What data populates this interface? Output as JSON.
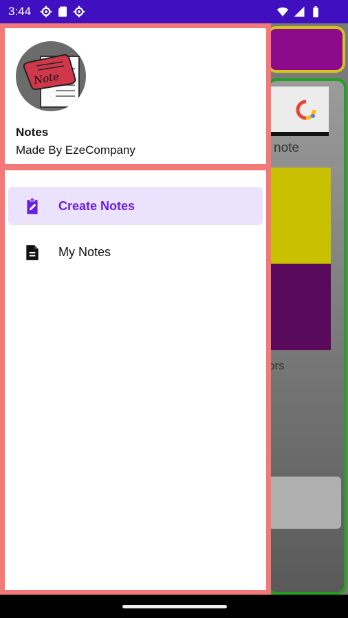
{
  "status_bar": {
    "time": "3:44",
    "left_icons": [
      "settings-icon",
      "sd-card-icon",
      "settings-icon"
    ],
    "right_icons": [
      "wifi-icon",
      "signal-icon",
      "battery-icon"
    ],
    "background_color": "#3f0fc0"
  },
  "drawer": {
    "header": {
      "title": "Notes",
      "subtitle": "Made By EzeCompany",
      "avatar_icon": "note-logo",
      "avatar_text": "Note"
    },
    "menu": [
      {
        "label": "Create Notes",
        "icon": "edit-note-icon",
        "active": true
      },
      {
        "label": "My Notes",
        "icon": "document-icon",
        "active": false
      }
    ],
    "accent_color": "#6b1fe0",
    "border_color": "#f37979"
  },
  "background_app": {
    "partial_label_1": "note",
    "partial_label_2": "ors"
  }
}
